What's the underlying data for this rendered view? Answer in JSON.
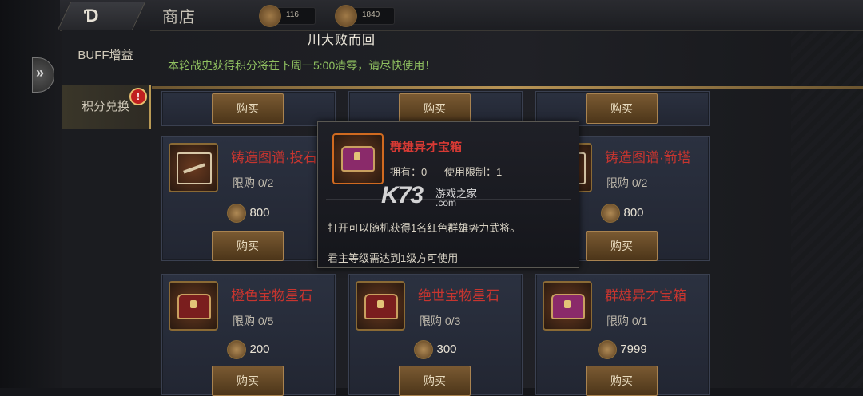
{
  "header": {
    "title": "商店",
    "currency_1": "116",
    "currency_2": "1840"
  },
  "marquee": "川大败而回",
  "sidebar": {
    "items": [
      {
        "label": "BUFF增益"
      },
      {
        "label": "积分兑换",
        "badge": "!"
      }
    ]
  },
  "notice": "本轮战史获得积分将在下周一5:00清零，请尽快使用！",
  "buy_label": "购买",
  "cards": [
    {
      "name": "铸造图谱·投石",
      "limit": "限购 0/2",
      "price": "800",
      "icon": "blueprint-icon"
    },
    {
      "name": "铸造图谱·箭塔",
      "limit": "限购 0/2",
      "price": "800",
      "icon": "blueprint-icon"
    },
    {
      "name": "橙色宝物星石",
      "limit": "限购 0/5",
      "price": "200",
      "icon": "chest-icon"
    },
    {
      "name": "绝世宝物星石",
      "limit": "限购 0/3",
      "price": "300",
      "icon": "chest-icon"
    },
    {
      "name": "群雄异才宝箱",
      "limit": "限购 0/1",
      "price": "7999",
      "icon": "hero-chest-icon"
    }
  ],
  "popup": {
    "name": "群雄异才宝箱",
    "own": "拥有：0",
    "limit": "使用限制：1",
    "desc": "打开可以随机获得1名红色群雄势力武将。",
    "requirement": "君主等级需达到1级方可使用"
  },
  "watermark": {
    "logo": "K73",
    "cn": "游戏之家",
    "com": ".com"
  }
}
